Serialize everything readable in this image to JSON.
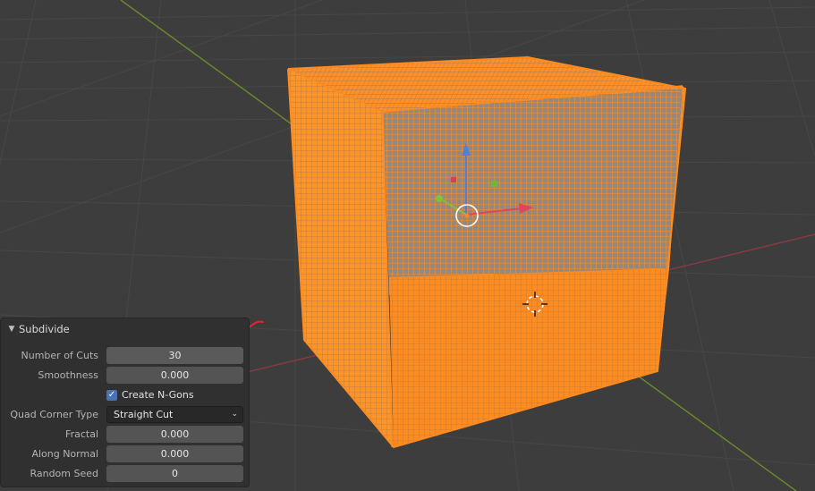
{
  "panel": {
    "title": "Subdivide",
    "fields": {
      "number_of_cuts": {
        "label": "Number of Cuts",
        "value": "30"
      },
      "smoothness": {
        "label": "Smoothness",
        "value": "0.000"
      },
      "create_ngons": {
        "label": "Create N-Gons",
        "checked": true
      },
      "quad_corner_type": {
        "label": "Quad Corner Type",
        "value": "Straight Cut"
      },
      "fractal": {
        "label": "Fractal",
        "value": "0.000"
      },
      "along_normal": {
        "label": "Along Normal",
        "value": "0.000"
      },
      "random_seed": {
        "label": "Random Seed",
        "value": "0"
      }
    }
  },
  "colors": {
    "viewport_bg": "#3d3d3d",
    "mesh_selected": "#ff8a1e",
    "x_axis": "#8a3a44",
    "y_axis": "#6b8a2c",
    "checkbox": "#4772b3",
    "annotation": "#e8232f"
  },
  "icons": {
    "collapse": "chevron-down-icon",
    "dropdown": "chevron-down-icon",
    "check": "checkmark-icon",
    "cursor3d": "3d-cursor-icon",
    "gizmo": "transform-gizmo-icon"
  }
}
